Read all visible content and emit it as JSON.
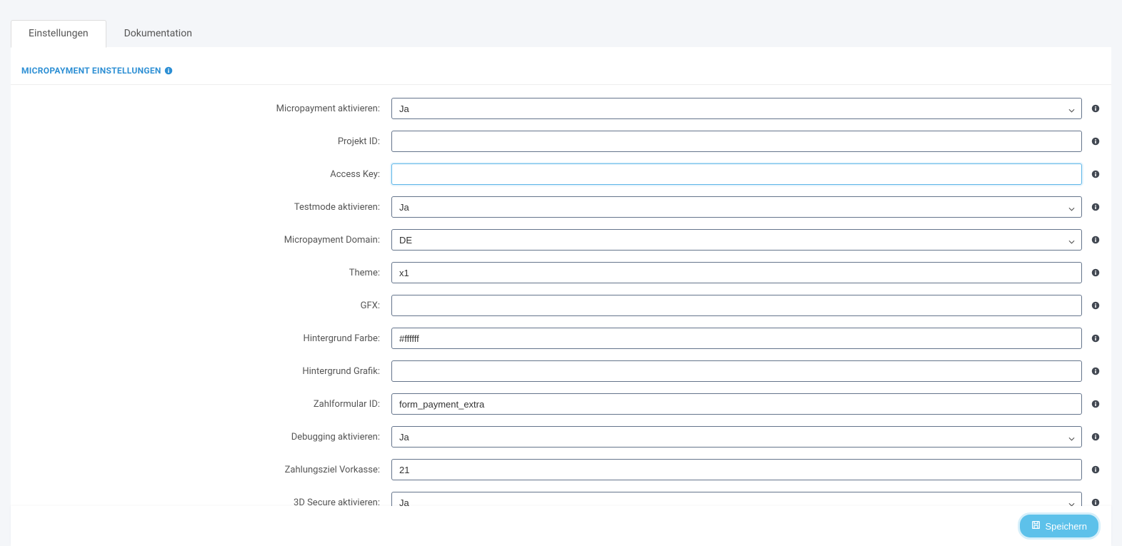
{
  "tabs": {
    "settings": "Einstellungen",
    "docs": "Dokumentation"
  },
  "section": {
    "title": "MICROPAYMENT EINSTELLUNGEN"
  },
  "fields": {
    "activate": {
      "label": "Micropayment aktivieren:",
      "value": "Ja"
    },
    "project_id": {
      "label": "Projekt ID:",
      "value": ""
    },
    "access_key": {
      "label": "Access Key:",
      "value": ""
    },
    "testmode": {
      "label": "Testmode aktivieren:",
      "value": "Ja"
    },
    "domain": {
      "label": "Micropayment Domain:",
      "value": "DE"
    },
    "theme": {
      "label": "Theme:",
      "value": "x1"
    },
    "gfx": {
      "label": "GFX:",
      "value": ""
    },
    "bgcolor": {
      "label": "Hintergrund Farbe:",
      "value": "#ffffff"
    },
    "bggraphic": {
      "label": "Hintergrund Grafik:",
      "value": ""
    },
    "payform_id": {
      "label": "Zahlformular ID:",
      "value": "form_payment_extra"
    },
    "debugging": {
      "label": "Debugging aktivieren:",
      "value": "Ja"
    },
    "prepay_target": {
      "label": "Zahlungsziel Vorkasse:",
      "value": "21"
    },
    "secure3d": {
      "label": "3D Secure aktivieren:",
      "value": "Ja"
    }
  },
  "footer": {
    "save": "Speichern"
  }
}
